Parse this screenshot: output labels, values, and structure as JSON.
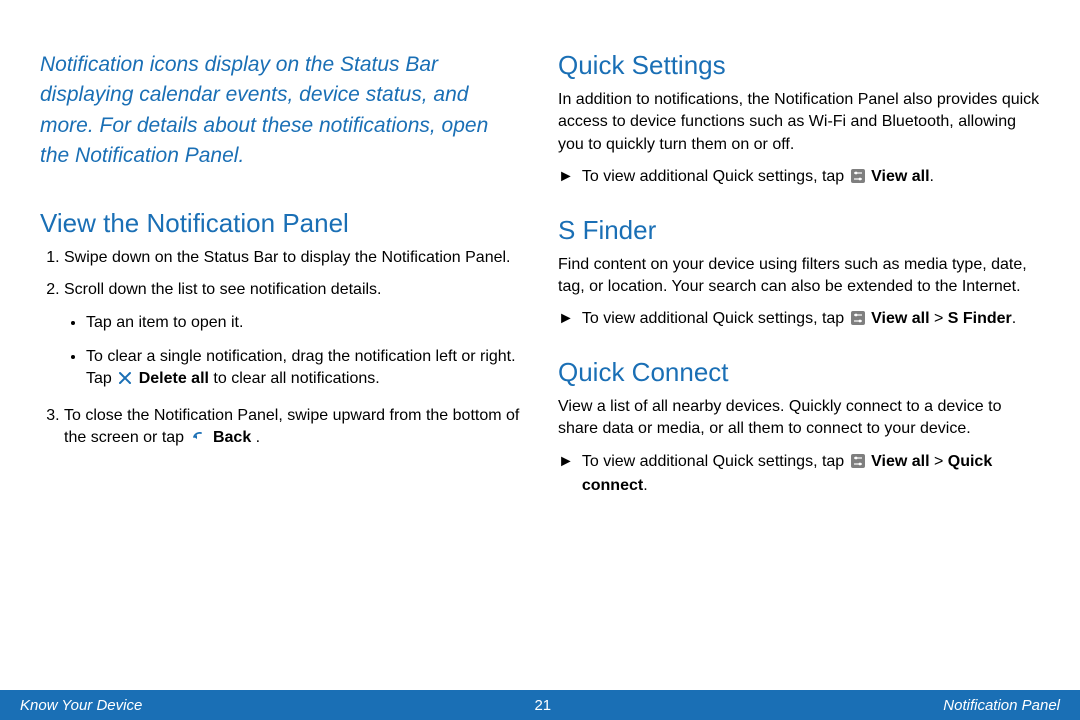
{
  "intro": "Notification icons display on the Status Bar displaying calendar events, device status, and more. For details about these notifications, open the Notification Panel.",
  "left": {
    "heading": "View the Notification Panel",
    "steps": {
      "s1": "Swipe down on the Status Bar to display the Notification Panel.",
      "s2": "Scroll down the list to see notification details.",
      "s2a": "Tap an item to open it.",
      "s2b_pre": "To clear a single notification, drag the notification left or right. Tap ",
      "s2b_bold": "Delete all",
      "s2b_post": " to clear all notifications.",
      "s3_pre": "To close the Notification Panel, swipe upward from the bottom of the screen or tap ",
      "s3_bold": "Back",
      "s3_post": "."
    }
  },
  "right": {
    "qs_heading": "Quick Settings",
    "qs_body": "In addition to notifications, the Notification Panel also provides quick access to device functions such as Wi-Fi and Bluetooth, allowing you to quickly turn them on or off.",
    "qs_arrow_pre": "To view additional Quick settings, tap ",
    "qs_arrow_bold": "View all",
    "qs_arrow_post": ".",
    "sf_heading": "S Finder",
    "sf_body": "Find content on your device using filters such as media type, date, tag, or location. Your search can also be extended to the Internet.",
    "sf_arrow_pre": "To view additional Quick settings, tap ",
    "sf_arrow_bold1": "View all",
    "sf_arrow_mid": " > ",
    "sf_arrow_bold2": "S Finder",
    "sf_arrow_post": ".",
    "qc_heading": "Quick Connect",
    "qc_body": "View a list of all nearby devices. Quickly connect to a device to share data or media, or all them to connect to your device.",
    "qc_arrow_pre": "To view additional Quick settings, tap ",
    "qc_arrow_bold1": "View all",
    "qc_arrow_mid": " > ",
    "qc_arrow_bold2": "Quick connect",
    "qc_arrow_post": "."
  },
  "footer": {
    "left": "Know Your Device",
    "page": "21",
    "right": "Notification Panel"
  },
  "glyphs": {
    "arrow": "►"
  }
}
